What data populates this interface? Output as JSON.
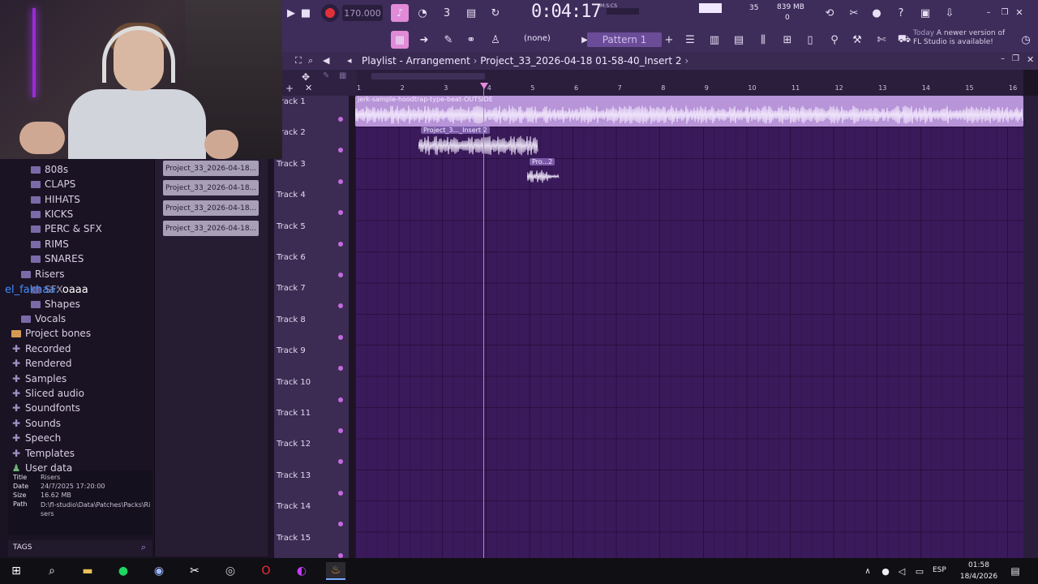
{
  "toolbar": {
    "tempo": "170.000",
    "time": "0:04:17",
    "time_unit": "M:S:CS",
    "cpu": "35",
    "memory": "839 MB",
    "memory_sub": "0",
    "pattern_selector": "(none)",
    "pattern": "Pattern 1",
    "news_date": "Today",
    "news_text": "A newer version of FL Studio is available!"
  },
  "playlist": {
    "title": "Playlist - Arrangement",
    "breadcrumb": "Project_33_2026-04-18 01-58-40_Insert 2",
    "ruler_ticks": [
      "1",
      "2",
      "3",
      "4",
      "5",
      "6",
      "7",
      "8",
      "9",
      "10",
      "11",
      "12",
      "13",
      "14",
      "15",
      "16"
    ],
    "tracks": [
      "Track 1",
      "Track 2",
      "Track 3",
      "Track 4",
      "Track 5",
      "Track 6",
      "Track 7",
      "Track 8",
      "Track 9",
      "Track 10",
      "Track 11",
      "Track 12",
      "Track 13",
      "Track 14",
      "Track 15"
    ],
    "clips": [
      {
        "label": "jerk-sample-hoodtrap-type-beat-OUTSIDE",
        "track": 1
      },
      {
        "label": "Project_3..._Insert 2",
        "track": 2
      },
      {
        "label": "Pro...2",
        "track": 3
      }
    ]
  },
  "browser": {
    "items": [
      {
        "label": "808s",
        "kind": "folder"
      },
      {
        "label": "CLAPS",
        "kind": "folder"
      },
      {
        "label": "HIHATS",
        "kind": "folder"
      },
      {
        "label": "KICKS",
        "kind": "folder"
      },
      {
        "label": "PERC & SFX",
        "kind": "folder"
      },
      {
        "label": "RIMS",
        "kind": "folder"
      },
      {
        "label": "SNARES",
        "kind": "folder"
      },
      {
        "label": "Risers",
        "kind": "folder"
      },
      {
        "label": "SFX",
        "kind": "folder"
      },
      {
        "label": "Shapes",
        "kind": "folder"
      },
      {
        "label": "Vocals",
        "kind": "folder"
      },
      {
        "label": "Project bones",
        "kind": "folder-open"
      },
      {
        "label": "Recorded",
        "kind": "plus"
      },
      {
        "label": "Rendered",
        "kind": "plus"
      },
      {
        "label": "Samples",
        "kind": "plus"
      },
      {
        "label": "Sliced audio",
        "kind": "plus"
      },
      {
        "label": "Soundfonts",
        "kind": "plus"
      },
      {
        "label": "Sounds",
        "kind": "plus"
      },
      {
        "label": "Speech",
        "kind": "plus"
      },
      {
        "label": "Templates",
        "kind": "plus"
      },
      {
        "label": "User data",
        "kind": "user"
      }
    ],
    "meta": {
      "title_label": "Title",
      "title_value": "Risers",
      "date_label": "Date",
      "date_value": "24/7/2025 17:20:00",
      "size_label": "Size",
      "size_value": "16.62 MB",
      "path_label": "Path",
      "path_value": "D:\\fl-studio\\Data\\Patches\\Packs\\Risers"
    },
    "tags_label": "TAGS"
  },
  "picker": {
    "clips": [
      "Project_33_2026-04-18...",
      "Project_33_2026-04-18...",
      "Project_33_2026-04-18...",
      "Project_33_2026-04-18..."
    ]
  },
  "chat": {
    "user": "el_fakhaa:",
    "message": "oaaa"
  },
  "taskbar": {
    "lang": "ESP",
    "time": "01:58",
    "date": "18/4/2026"
  },
  "colors": {
    "accent": "#b48ed6",
    "record": "#e0303a",
    "grid": "#3a1a5a"
  }
}
